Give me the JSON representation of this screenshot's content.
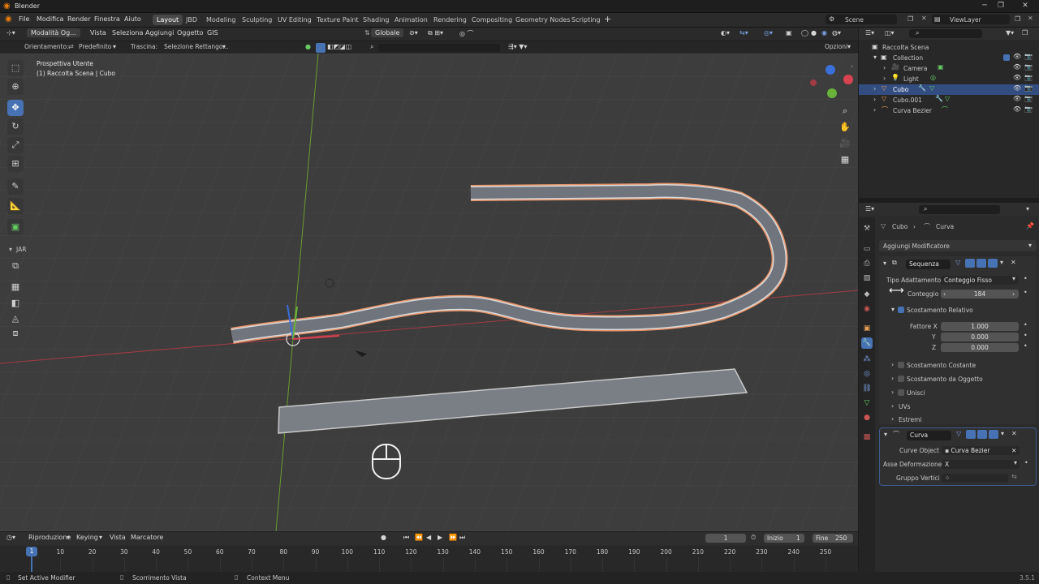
{
  "app": {
    "title": "Blender",
    "version": "3.5.1"
  },
  "menu": {
    "items": [
      "File",
      "Modifica",
      "Render",
      "Finestra",
      "Aiuto"
    ]
  },
  "workspaces": [
    "Layout",
    "JBD",
    "Modeling",
    "Sculpting",
    "UV Editing",
    "Texture Paint",
    "Shading",
    "Animation",
    "Rendering",
    "Compositing",
    "Geometry Nodes",
    "Scripting"
  ],
  "active_workspace": "Layout",
  "scene": {
    "name": "Scene",
    "view_layer": "ViewLayer"
  },
  "viewport_header": {
    "mode": "Modalità Og...",
    "menus": [
      "Vista",
      "Seleziona",
      "Aggiungi",
      "Oggetto",
      "GIS"
    ],
    "transform": "Globale"
  },
  "viewport_header2": {
    "orient_label": "Orientamento:",
    "orient_value": "Predefinito",
    "drag_label": "Trascina:",
    "drag_value": "Selezione Rettango...",
    "options": "Opzioni"
  },
  "viewport": {
    "view_name": "Prospettiva Utente",
    "context": "(1) Raccolta Scena | Cubo",
    "jar_label": "JAR"
  },
  "outliner": {
    "root": "Raccolta Scena",
    "rows": [
      {
        "name": "Collection",
        "icon": "collection-icon"
      },
      {
        "name": "Camera",
        "icon": "camera-icon"
      },
      {
        "name": "Light",
        "icon": "light-icon"
      },
      {
        "name": "Cubo",
        "icon": "mesh-icon",
        "selected": true
      },
      {
        "name": "Cubo.001",
        "icon": "mesh-icon"
      },
      {
        "name": "Curva Bezier",
        "icon": "curve-icon"
      }
    ]
  },
  "properties": {
    "breadcrumb_object": "Cubo",
    "breadcrumb_modifier": "Curva",
    "add_modifier": "Aggiungi Modificatore",
    "array_modifier": {
      "name": "Sequenza",
      "fit_type_label": "Tipo Adattamento",
      "fit_type_value": "Conteggio Fisso",
      "count_label": "Conteggio",
      "count_value": "184",
      "relative_offset": "Scostamento Relativo",
      "factor_label": "Fattore X",
      "factor_x": "1.000",
      "y_label": "Y",
      "factor_y": "0.000",
      "z_label": "Z",
      "factor_z": "0.000",
      "subpanels": [
        "Scostamento Costante",
        "Scostamento da Oggetto",
        "Unisci",
        "UVs",
        "Estremi"
      ]
    },
    "curve_modifier": {
      "name": "Curva",
      "curve_object_label": "Curve Object",
      "curve_object_value": "Curva Bezier",
      "deform_axis_label": "Asse Deformazione",
      "deform_axis_value": "X",
      "vertex_group_label": "Gruppo Vertici"
    }
  },
  "timeline": {
    "menus": [
      "Riproduzione",
      "Keying",
      "Vista",
      "Marcatore"
    ],
    "current_frame": "1",
    "start_label": "Inizio",
    "start": "1",
    "end_label": "Fine",
    "end": "250",
    "ticks": [
      "1",
      "10",
      "20",
      "30",
      "40",
      "50",
      "60",
      "70",
      "80",
      "90",
      "100",
      "110",
      "120",
      "130",
      "140",
      "150",
      "160",
      "170",
      "180",
      "190",
      "200",
      "210",
      "220",
      "230",
      "240",
      "250"
    ]
  },
  "statusbar": {
    "left": "Set Active Modifier",
    "middle": "Scorrimento Vista",
    "right": "Context Menu"
  },
  "colors": {
    "accent": "#4772b3",
    "selected_row": "#334d80",
    "viewport_bg": "#3d3d3d",
    "selection_outline": "#e8956a"
  }
}
